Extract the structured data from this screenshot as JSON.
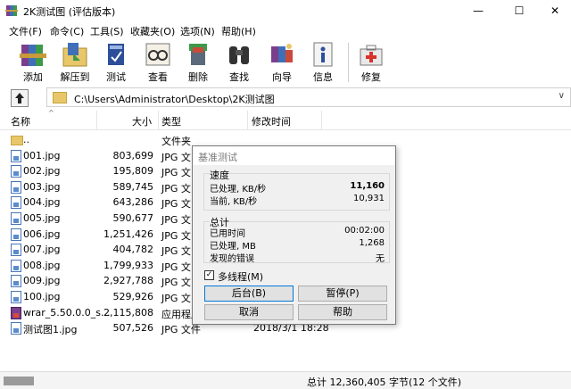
{
  "window": {
    "title": "2K测试图 (评估版本)",
    "minimize_glyph": "—",
    "maximize_glyph": "☐",
    "close_glyph": "✕"
  },
  "menu": [
    {
      "label": "文件(F)"
    },
    {
      "label": "命令(C)"
    },
    {
      "label": "工具(S)"
    },
    {
      "label": "收藏夹(O)"
    },
    {
      "label": "选项(N)"
    },
    {
      "label": "帮助(H)"
    }
  ],
  "toolbar": [
    {
      "label": "添加",
      "icon": "add-books-icon"
    },
    {
      "label": "解压到",
      "icon": "extract-folder-icon"
    },
    {
      "label": "测试",
      "icon": "test-book-icon"
    },
    {
      "label": "查看",
      "icon": "view-glasses-icon"
    },
    {
      "label": "删除",
      "icon": "delete-trash-icon"
    },
    {
      "label": "查找",
      "icon": "find-binoculars-icon"
    },
    {
      "label": "向导",
      "icon": "wizard-icon"
    },
    {
      "label": "信息",
      "icon": "info-icon"
    },
    {
      "label": "修复",
      "icon": "repair-kit-icon"
    }
  ],
  "address": {
    "path": "C:\\Users\\Administrator\\Desktop\\2K测试图",
    "dropdown_glyph": "∨"
  },
  "columns": {
    "name": "名称",
    "size": "大小",
    "type": "类型",
    "modified": "修改时间"
  },
  "files": [
    {
      "name": "..",
      "size": "",
      "type": "文件夹",
      "modified": "",
      "kind": "folder"
    },
    {
      "name": "001.jpg",
      "size": "803,699",
      "type": "JPG 文",
      "modified": "",
      "kind": "jpg"
    },
    {
      "name": "002.jpg",
      "size": "195,809",
      "type": "JPG 文",
      "modified": "",
      "kind": "jpg"
    },
    {
      "name": "003.jpg",
      "size": "589,745",
      "type": "JPG 文",
      "modified": "",
      "kind": "jpg"
    },
    {
      "name": "004.jpg",
      "size": "643,286",
      "type": "JPG 文",
      "modified": "",
      "kind": "jpg"
    },
    {
      "name": "005.jpg",
      "size": "590,677",
      "type": "JPG 文",
      "modified": "",
      "kind": "jpg"
    },
    {
      "name": "006.jpg",
      "size": "1,251,426",
      "type": "JPG 文",
      "modified": "",
      "kind": "jpg"
    },
    {
      "name": "007.jpg",
      "size": "404,782",
      "type": "JPG 文",
      "modified": "",
      "kind": "jpg"
    },
    {
      "name": "008.jpg",
      "size": "1,799,933",
      "type": "JPG 文",
      "modified": "",
      "kind": "jpg"
    },
    {
      "name": "009.jpg",
      "size": "2,927,788",
      "type": "JPG 文",
      "modified": "",
      "kind": "jpg"
    },
    {
      "name": "100.jpg",
      "size": "529,926",
      "type": "JPG 文",
      "modified": "",
      "kind": "jpg"
    },
    {
      "name": "wrar_5.50.0.0_s...",
      "size": "2,115,808",
      "type": "应用程序",
      "modified": "",
      "kind": "exe"
    },
    {
      "name": "测试图1.jpg",
      "size": "507,526",
      "type": "JPG 文件",
      "modified": "2018/3/1 18:28",
      "kind": "jpg"
    }
  ],
  "status": {
    "text": "总计 12,360,405 字节(12 个文件)"
  },
  "dialog": {
    "title": "基准测试",
    "speed_group": "速度",
    "processed_rate_label": "已处理, KB/秒",
    "processed_rate_value": "11,160",
    "current_rate_label": "当前, KB/秒",
    "current_rate_value": "10,931",
    "total_group": "总计",
    "elapsed_label": "已用时间",
    "elapsed_value": "00:02:00",
    "processed_mb_label": "已处理, MB",
    "processed_mb_value": "1,268",
    "errors_label": "发现的错误",
    "errors_value": "无",
    "multithread_label": "多线程(M)",
    "multithread_checked": true,
    "checkmark": "✓",
    "background_btn": "后台(B)",
    "pause_btn": "暂停(P)",
    "cancel_btn": "取消",
    "help_btn": "帮助"
  }
}
